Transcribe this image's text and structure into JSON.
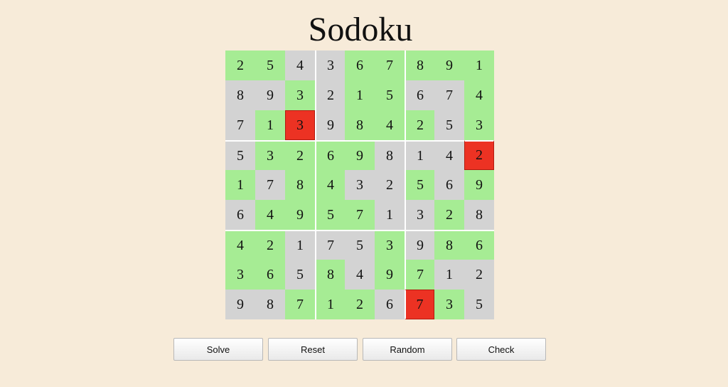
{
  "title": "Sodoku",
  "colors": {
    "background": "#f7ebd9",
    "correct": "#a6ec94",
    "neutral": "#d3d3d3",
    "conflict": "#ec3223"
  },
  "board": {
    "values": [
      [
        2,
        5,
        4,
        3,
        6,
        7,
        8,
        9,
        1
      ],
      [
        8,
        9,
        3,
        2,
        1,
        5,
        6,
        7,
        4
      ],
      [
        7,
        1,
        3,
        9,
        8,
        4,
        2,
        5,
        3
      ],
      [
        5,
        3,
        2,
        6,
        9,
        8,
        1,
        4,
        2
      ],
      [
        1,
        7,
        8,
        4,
        3,
        2,
        5,
        6,
        9
      ],
      [
        6,
        4,
        9,
        5,
        7,
        1,
        3,
        2,
        8
      ],
      [
        4,
        2,
        1,
        7,
        5,
        3,
        9,
        8,
        6
      ],
      [
        3,
        6,
        5,
        8,
        4,
        9,
        7,
        1,
        2
      ],
      [
        9,
        8,
        7,
        1,
        2,
        6,
        7,
        3,
        5
      ]
    ],
    "states": [
      [
        "g",
        "g",
        "n",
        "n",
        "g",
        "g",
        "g",
        "g",
        "g"
      ],
      [
        "n",
        "n",
        "g",
        "n",
        "g",
        "g",
        "n",
        "n",
        "g"
      ],
      [
        "n",
        "g",
        "r",
        "n",
        "g",
        "g",
        "g",
        "n",
        "g"
      ],
      [
        "n",
        "g",
        "g",
        "g",
        "g",
        "n",
        "n",
        "n",
        "r"
      ],
      [
        "g",
        "n",
        "g",
        "g",
        "n",
        "n",
        "g",
        "n",
        "g"
      ],
      [
        "n",
        "g",
        "g",
        "g",
        "g",
        "n",
        "n",
        "g",
        "n"
      ],
      [
        "g",
        "g",
        "n",
        "n",
        "n",
        "g",
        "n",
        "g",
        "g"
      ],
      [
        "g",
        "g",
        "n",
        "g",
        "n",
        "g",
        "g",
        "n",
        "n"
      ],
      [
        "n",
        "n",
        "g",
        "g",
        "g",
        "n",
        "r",
        "g",
        "n"
      ]
    ]
  },
  "buttons": {
    "solve": "Solve",
    "reset": "Reset",
    "random": "Random",
    "check": "Check"
  }
}
